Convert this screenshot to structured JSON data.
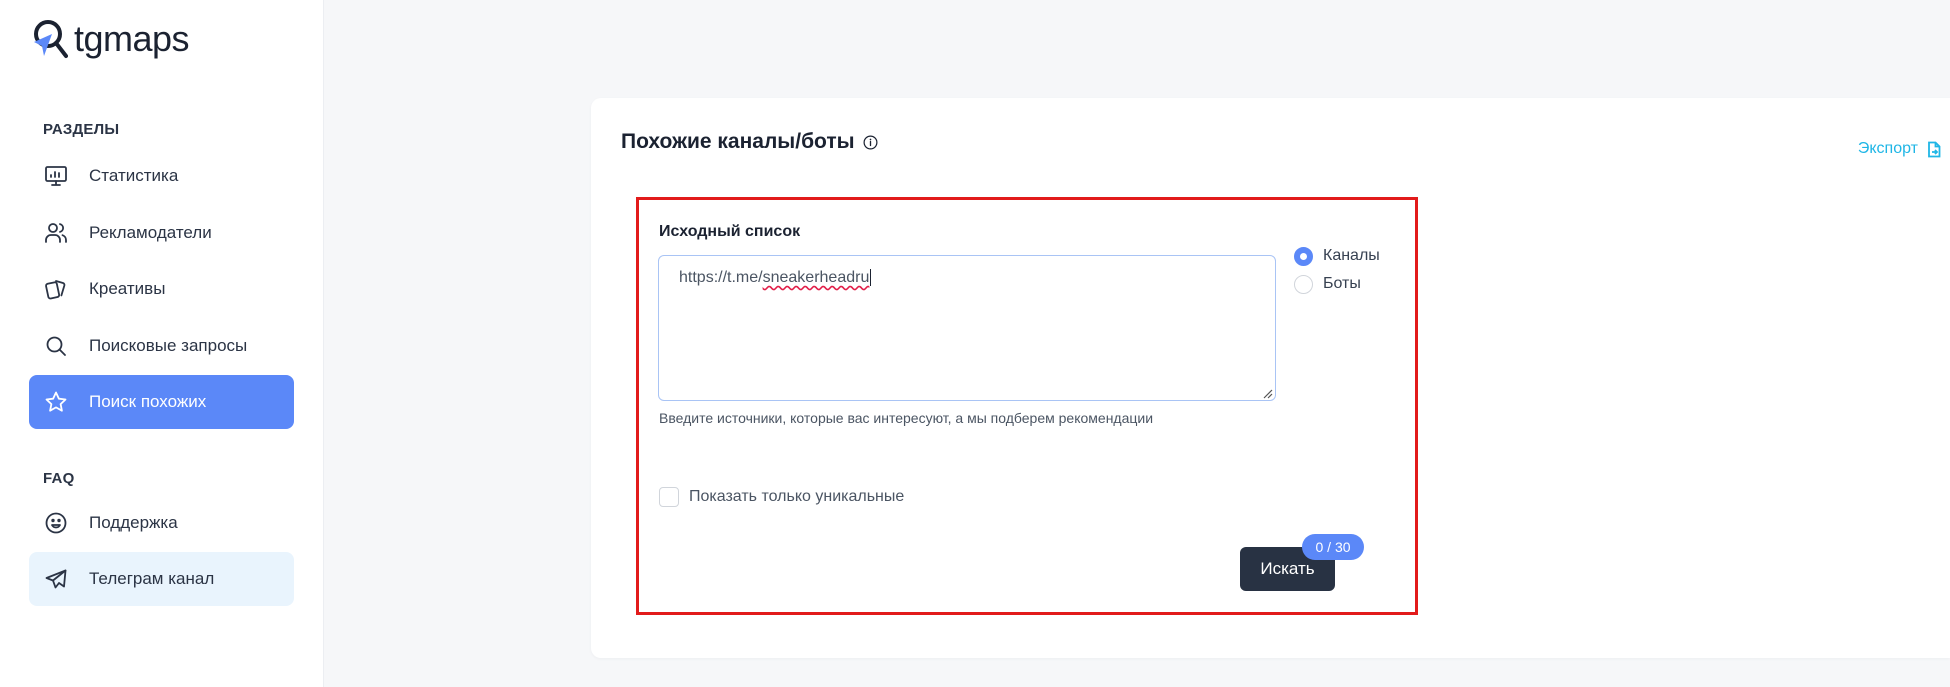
{
  "brand": {
    "name": "tgmaps"
  },
  "sidebar": {
    "sections": [
      {
        "title": "РАЗДЕЛЫ",
        "items": [
          {
            "label": "Статистика",
            "icon": "monitor-chart-icon"
          },
          {
            "label": "Рекламодатели",
            "icon": "users-icon"
          },
          {
            "label": "Креативы",
            "icon": "cards-icon"
          },
          {
            "label": "Поисковые запросы",
            "icon": "search-icon"
          },
          {
            "label": "Поиск похожих",
            "icon": "star-icon",
            "active": true
          }
        ]
      },
      {
        "title": "FAQ",
        "items": [
          {
            "label": "Поддержка",
            "icon": "smile-icon"
          },
          {
            "label": "Телеграм канал",
            "icon": "telegram-icon"
          }
        ]
      }
    ]
  },
  "main": {
    "title": "Похожие каналы/боты",
    "export_label": "Экспорт",
    "form": {
      "source_label": "Исходный список",
      "source_value_prefix": "https://t.me/",
      "source_value_handle": "sneakerheadru",
      "hint": "Введите источники, которые вас интересуют, а мы подберем рекомендации",
      "type_options": [
        {
          "label": "Каналы",
          "checked": true
        },
        {
          "label": "Боты",
          "checked": false
        }
      ],
      "unique_only_label": "Показать только уникальные",
      "submit_label": "Искать",
      "counter": "0 / 30"
    }
  },
  "colors": {
    "accent": "#5b88f8",
    "dark_button": "#283243",
    "link": "#1fb6e6",
    "highlight_border": "#e21b1b"
  }
}
